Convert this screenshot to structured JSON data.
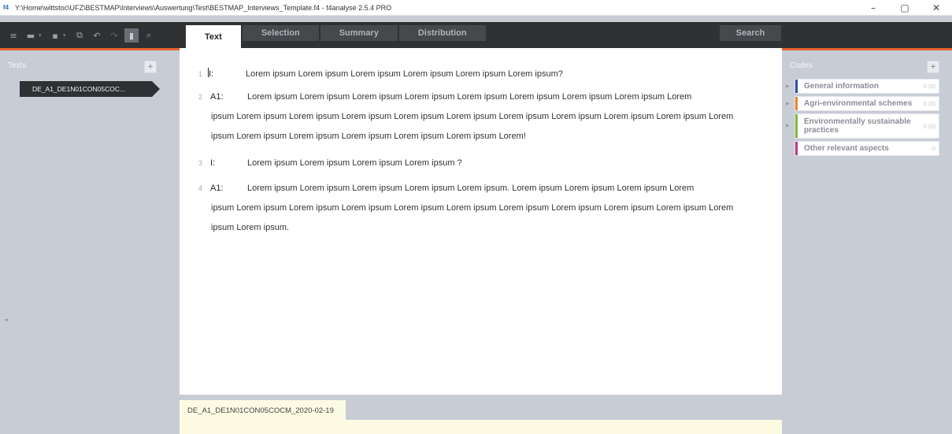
{
  "window": {
    "title": "Y:\\Home\\wittstoc\\UFZ\\BESTMAP\\Interviews\\Auswertung\\Test\\BESTMAP_Interviews_Template.f4 - f4analyse 2.5.4 PRO",
    "app_icon": "f4",
    "minimize_glyph": "–",
    "maximize_glyph": "▢",
    "close_glyph": "✕"
  },
  "toolbar": {
    "icons": [
      "menu-icon",
      "folder-icon",
      "save-icon",
      "export-icon",
      "undo-icon",
      "redo-icon",
      "bookmark-icon",
      "search-icon"
    ]
  },
  "tabs": [
    {
      "label": "Text",
      "active": true
    },
    {
      "label": "Selection",
      "active": false
    },
    {
      "label": "Summary",
      "active": false
    },
    {
      "label": "Distribution",
      "active": false
    }
  ],
  "search_tab": {
    "label": "Search"
  },
  "texts_panel": {
    "label": "Texts",
    "add_label": "+",
    "items": [
      {
        "label": "DE_A1_DE1N01CON05COC..."
      }
    ]
  },
  "transcript": {
    "paragraphs": [
      {
        "number": "1",
        "speaker": "I:",
        "text": "Lorem ipsum Lorem ipsum Lorem ipsum Lorem ipsum Lorem ipsum Lorem ipsum?"
      },
      {
        "number": "2",
        "speaker": "A1:",
        "text": "Lorem ipsum Lorem ipsum Lorem ipsum Lorem ipsum Lorem ipsum Lorem ipsum Lorem ipsum Lorem ipsum Lorem",
        "continuation": "ipsum Lorem ipsum Lorem ipsum Lorem ipsum Lorem ipsum Lorem ipsum Lorem ipsum Lorem ipsum Lorem ipsum Lorem ipsum Lorem ipsum Lorem ipsum Lorem ipsum Lorem ipsum Lorem ipsum Lorem ipsum Lorem!"
      },
      {
        "number": "3",
        "speaker": "I:",
        "text": "Lorem ipsum Lorem ipsum Lorem ipsum Lorem ipsum ?"
      },
      {
        "number": "4",
        "speaker": "A1:",
        "text": "Lorem ipsum Lorem ipsum Lorem ipsum Lorem ipsum Lorem ipsum. Lorem ipsum Lorem ipsum Lorem ipsum Lorem",
        "continuation": "ipsum Lorem ipsum Lorem ipsum Lorem ipsum Lorem ipsum Lorem ipsum Lorem ipsum Lorem ipsum Lorem ipsum Lorem ipsum Lorem ipsum Lorem ipsum."
      }
    ]
  },
  "bottom_tab": {
    "label": "DE_A1_DE1N01CON05COCM_2020-02-19"
  },
  "codes_panel": {
    "label": "Codes",
    "add_label": "+",
    "items": [
      {
        "label": "General information",
        "count": "0 (0)",
        "color": "#2b4fa8",
        "has_children": true
      },
      {
        "label": "Agri-environmental schemes",
        "count": "0 (0)",
        "color": "#e8862a",
        "has_children": true
      },
      {
        "label": "Environmentally sustainable practices",
        "count": "0 (0)",
        "color": "#7dbb3c",
        "has_children": true
      },
      {
        "label": "Other relevant aspects",
        "count": "0",
        "color": "#c0358a",
        "has_children": false
      }
    ]
  }
}
